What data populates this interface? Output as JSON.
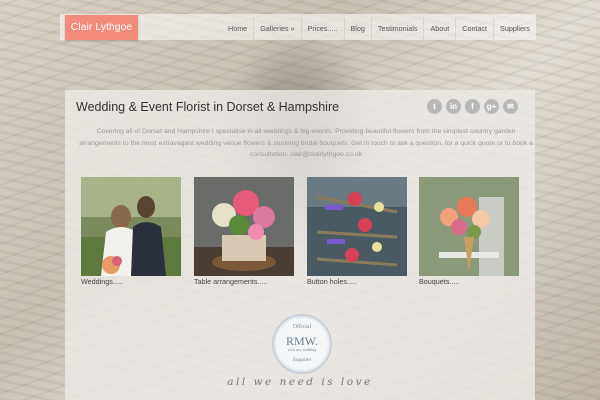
{
  "header": {
    "logo": "Clair Lythgoe",
    "nav": [
      "Home",
      "Galleries »",
      "Prices.....",
      "Blog",
      "Testimonials",
      "About",
      "Contact",
      "Suppliers"
    ]
  },
  "main": {
    "heading": "Wedding & Event Florist in Dorset & Hampshire",
    "social": [
      {
        "icon": "twitter-icon",
        "glyph": "t"
      },
      {
        "icon": "linkedin-icon",
        "glyph": "in"
      },
      {
        "icon": "facebook-icon",
        "glyph": "f"
      },
      {
        "icon": "google-plus-icon",
        "glyph": "g+"
      },
      {
        "icon": "email-icon",
        "glyph": "✉"
      }
    ],
    "intro": "Covering all of Dorset and Hampshire I specialise in all weddings & big events. Providing beautiful flowers from the simplest country garden arrangements to the most extravagant wedding venue flowers & stunning bridal bouquets. Get in touch to ask a question, for a quick quote or to book a consultation: clair@clairlythgoe.co.uk",
    "galleries": [
      {
        "caption": "Weddings.....",
        "image": "wedding-couple-photo"
      },
      {
        "caption": "Table arrangements.....",
        "image": "table-arrangement-photo"
      },
      {
        "caption": "Button holes.....",
        "image": "button-holes-photo"
      },
      {
        "caption": "Bouquets.....",
        "image": "bouquet-photo"
      }
    ],
    "badge": {
      "top": "Official",
      "main": "RMW.",
      "sub": "rock my wedding",
      "bottom": "Supplier"
    },
    "tagline": "all we need is love"
  }
}
